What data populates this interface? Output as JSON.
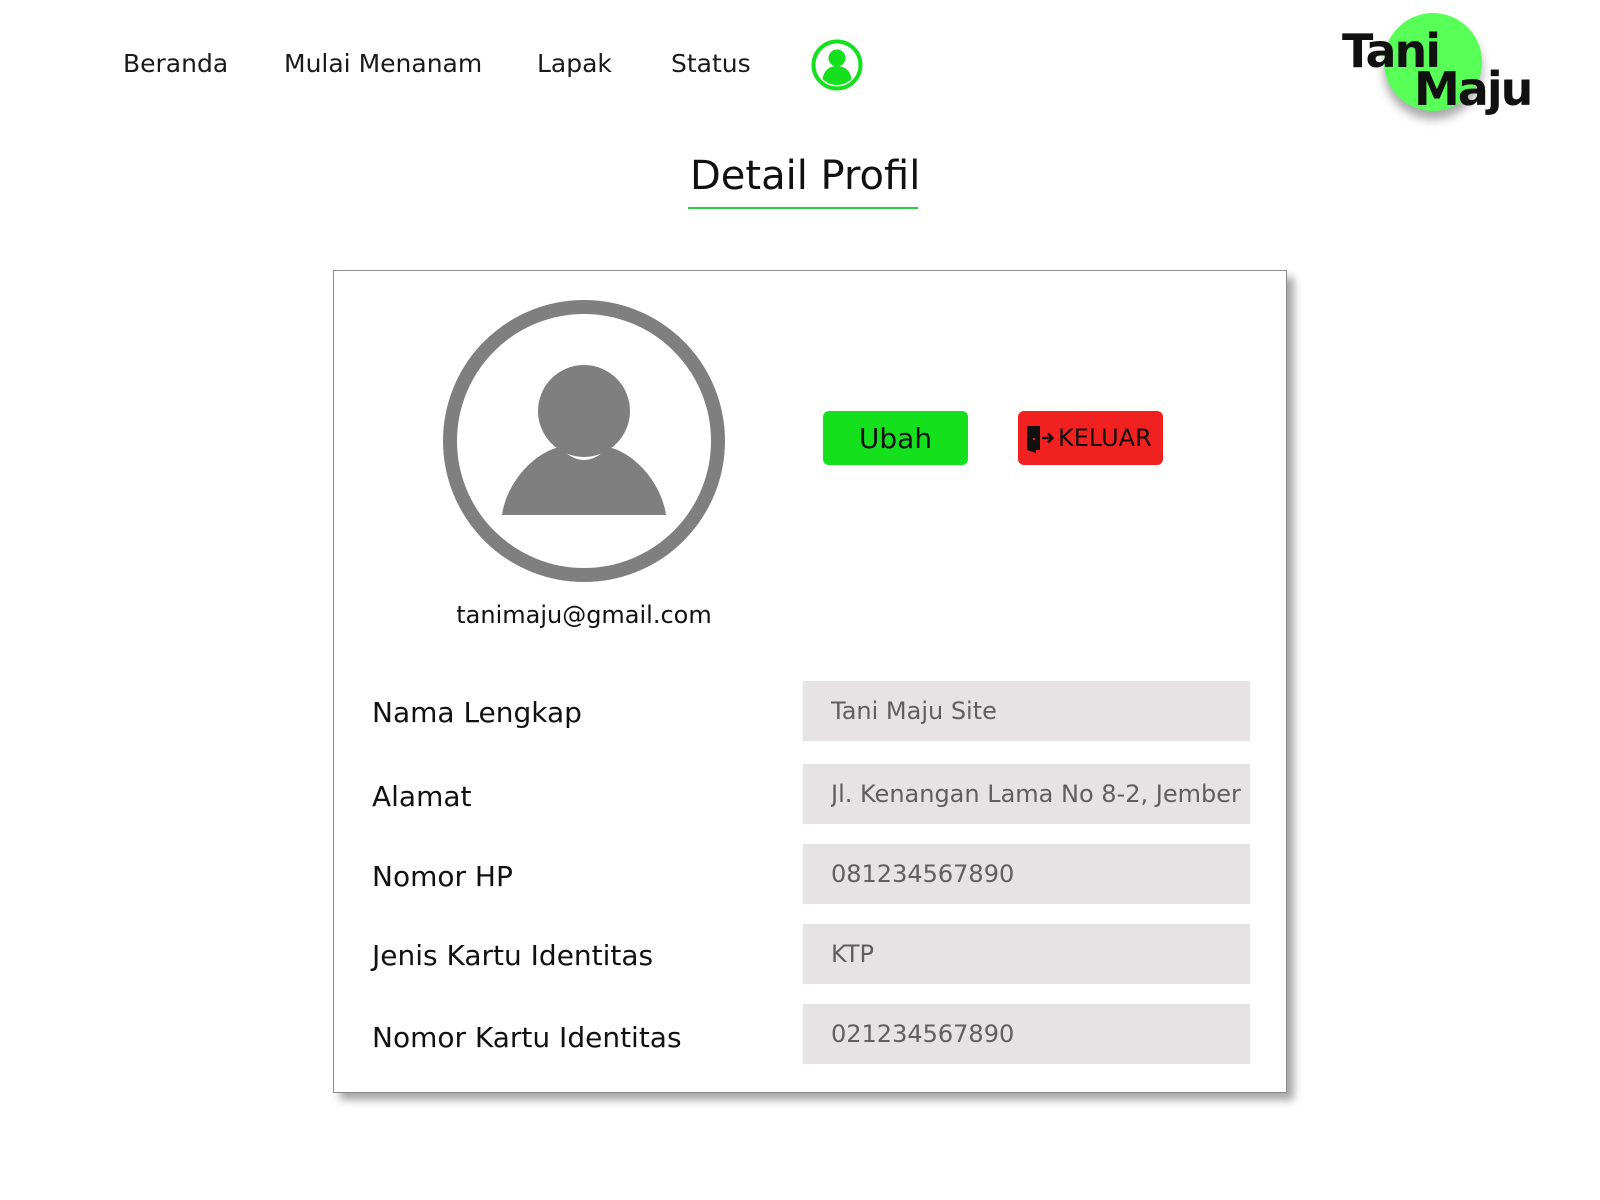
{
  "nav": {
    "items": [
      {
        "label": "Beranda"
      },
      {
        "label": "Mulai Menanam"
      },
      {
        "label": "Lapak"
      },
      {
        "label": "Status"
      }
    ],
    "profile_icon": "user-circle-icon"
  },
  "logo": {
    "line1": "Tani",
    "line2": "Maju"
  },
  "page": {
    "title": "Detail Profil"
  },
  "profile": {
    "avatar_icon": "user-avatar-icon",
    "email": "tanimaju@gmail.com"
  },
  "actions": {
    "edit_label": "Ubah",
    "logout_label": "KELUAR",
    "logout_icon": "door-exit-icon"
  },
  "fields": [
    {
      "label": "Nama Lengkap",
      "value": "Tani Maju Site"
    },
    {
      "label": "Alamat",
      "value": "Jl. Kenangan Lama No 8-2, Jember"
    },
    {
      "label": "Nomor HP",
      "value": "081234567890"
    },
    {
      "label": "Jenis Kartu Identitas",
      "value": "KTP"
    },
    {
      "label": "Nomor Kartu Identitas",
      "value": "021234567890"
    }
  ],
  "colors": {
    "accent_green": "#14e01e",
    "logo_green": "#57ff57",
    "danger_red": "#f22121",
    "input_bg": "#e5e3e3",
    "avatar_gray": "#7f7f7f"
  }
}
